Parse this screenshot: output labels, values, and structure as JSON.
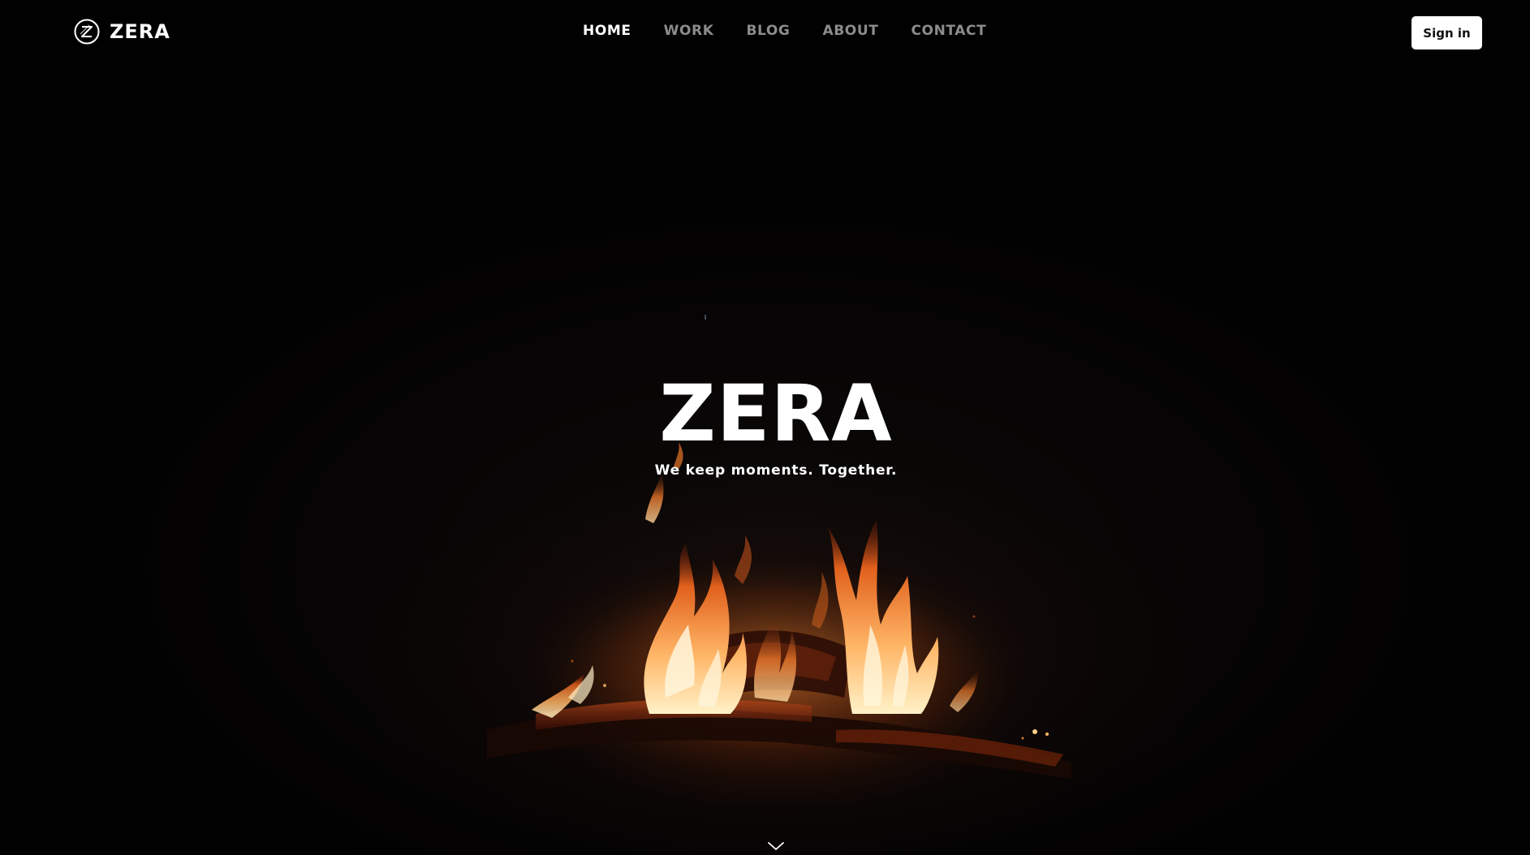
{
  "brand": {
    "name": "ZERA",
    "logo_icon": "circle-z-icon"
  },
  "nav": {
    "items": [
      {
        "label": "HOME",
        "active": true
      },
      {
        "label": "WORK",
        "active": false
      },
      {
        "label": "BLOG",
        "active": false
      },
      {
        "label": "ABOUT",
        "active": false
      },
      {
        "label": "CONTACT",
        "active": false
      }
    ]
  },
  "header": {
    "signin_label": "Sign in"
  },
  "hero": {
    "title": "ZERA",
    "tagline": "We keep moments. Together.",
    "background": "campfire-at-night",
    "scroll_icon": "chevron-down-icon"
  },
  "colors": {
    "background": "#020101",
    "text": "#ffffff",
    "nav_inactive": "#8c8c8c",
    "button_bg": "#ffffff",
    "button_text": "#111111",
    "fire": "#f08a3a"
  }
}
